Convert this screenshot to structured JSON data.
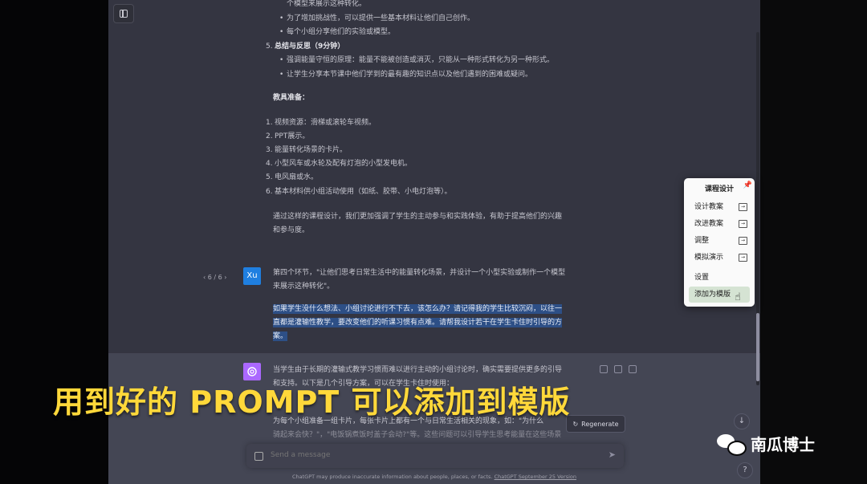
{
  "upper_text": {
    "l1": "个模型来展示这种转化。",
    "l2": "为了增加挑战性，可以提供一些基本材料让他们自己创作。",
    "l3": "每个小组分享他们的实验或模型。",
    "s5_num": "5.",
    "s5_title": "总结与反思（9分钟）",
    "l5a": "强调能量守恒的原理：能量不能被创造或消灭，只能从一种形式转化为另一种形式。",
    "l5b": "让学生分享本节课中他们学到的最有趣的知识点以及他们遇到的困难或疑问。",
    "prep_title": "教具准备：",
    "prep": [
      {
        "n": "1.",
        "t": "视频资源：滑梯或滚轮车视频。"
      },
      {
        "n": "2.",
        "t": "PPT展示。"
      },
      {
        "n": "3.",
        "t": "能量转化场景的卡片。"
      },
      {
        "n": "4.",
        "t": "小型风车或水轮及配有灯泡的小型发电机。"
      },
      {
        "n": "5.",
        "t": "电风扇或水。"
      },
      {
        "n": "6.",
        "t": "基本材料供小组活动使用（如纸、胶带、小电灯泡等）。"
      }
    ],
    "closing1": "通过这样的课程设计，我们更加强调了学生的主动参与和实践体验，有助于提高他们的兴趣",
    "closing2": "和参与度。"
  },
  "user_msg": {
    "pager": "‹ 6 / 6 ›",
    "avatar": "Xu",
    "p1a": "第四个环节，\"让他们思考日常生活中的能量转化场景，并设计一个小型实验或制作一个模型",
    "p1b": "来展示这种转化\"。",
    "h1": "如果学生没什么想法、小组讨论进行不下去，该怎么办？请记得我的学生比较沉闷，以往一",
    "h2": "直都是灌输性教学，要改变他们的听课习惯有点难。请帮我设计若干在学生卡住时引导的方",
    "h3": "案。"
  },
  "ai_msg": {
    "l1": "当学生由于长期的灌输式教学习惯而难以进行主动的小组讨论时，确实需要提供更多的引导",
    "l2": "和支持。以下是几个引导方案，可以在学生卡住时使用：",
    "l3": "为每个小组准备一组卡片，每张卡片上都有一个与日常生活相关的现象，如：\"为什么",
    "l4": "骑起来会快？\"，\"电饭锅煮饭时盖子会动?\"等。这些问题可以引导学生思考能量在这些场景"
  },
  "popup": {
    "title": "课程设计",
    "items": [
      "设计教案",
      "改进教案",
      "调整",
      "模拟演示"
    ],
    "settings": "设置",
    "add_template": "添加为模版"
  },
  "regenerate_label": "Regenerate",
  "input_placeholder": "Send a message",
  "footer": {
    "text": "ChatGPT may produce inaccurate information about people, places, or facts.",
    "link": "ChatGPT September 25 Version"
  },
  "caption": "用到好的 PROMPT 可以添加到模版",
  "watermark": "南瓜博士",
  "colors": {
    "chat_bg": "#343541",
    "ai_bg": "#444654",
    "highlight": "#2d4f86",
    "caption": "#ffd83a",
    "user_avatar": "#1f7fe0",
    "gpt_avatar": "#ab68ff"
  }
}
